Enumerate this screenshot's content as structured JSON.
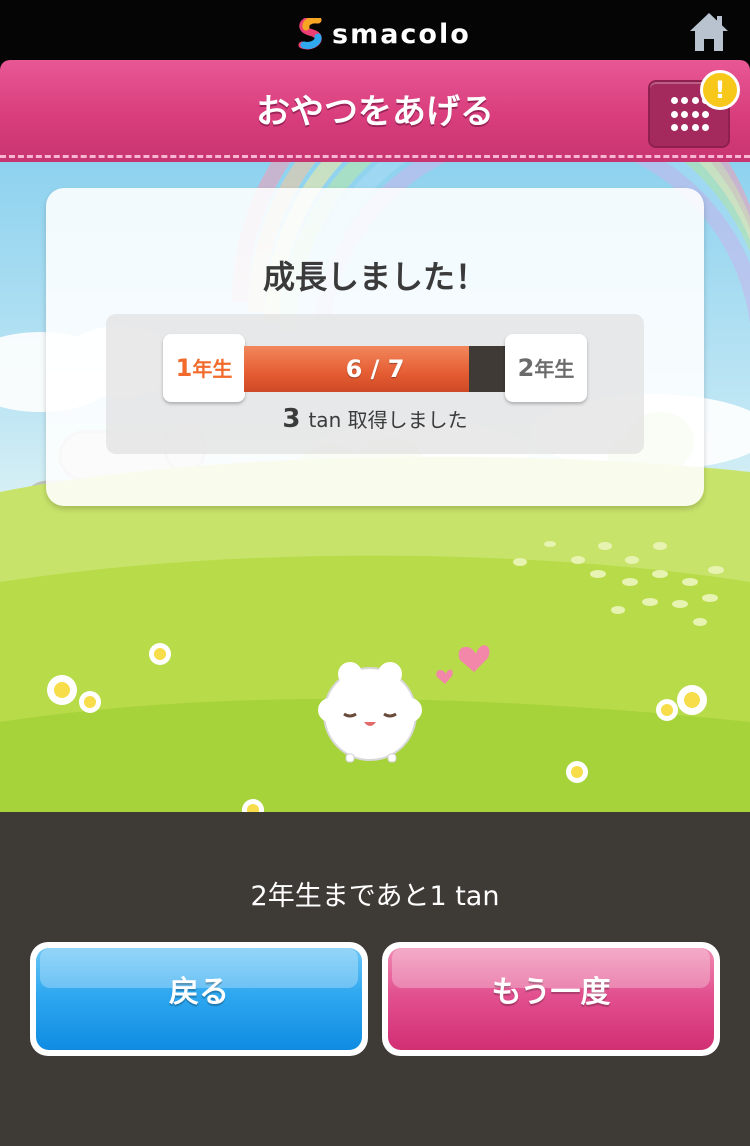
{
  "topbar": {
    "app_name": "smacolo"
  },
  "header": {
    "title": "おやつをあげる",
    "notification_badge": "!"
  },
  "result": {
    "title": "成長しました！",
    "from_grade_num": "1",
    "from_grade_unit": "年生",
    "to_grade_num": "2",
    "to_grade_unit": "年生",
    "progress_text": "6 / 7",
    "progress_value": 6,
    "progress_max": 7,
    "tan_count": "3",
    "tan_text": "tan 取得しました"
  },
  "bottom": {
    "remaining_text": "2年生まであと1 tan",
    "back_label": "戻る",
    "again_label": "もう一度"
  },
  "colors": {
    "header_pink": "#d93d7c",
    "progress_orange": "#e55c32",
    "back_blue": "#1a97ea",
    "again_pink": "#dd4585",
    "grade_one_orange": "#f26b2c"
  }
}
